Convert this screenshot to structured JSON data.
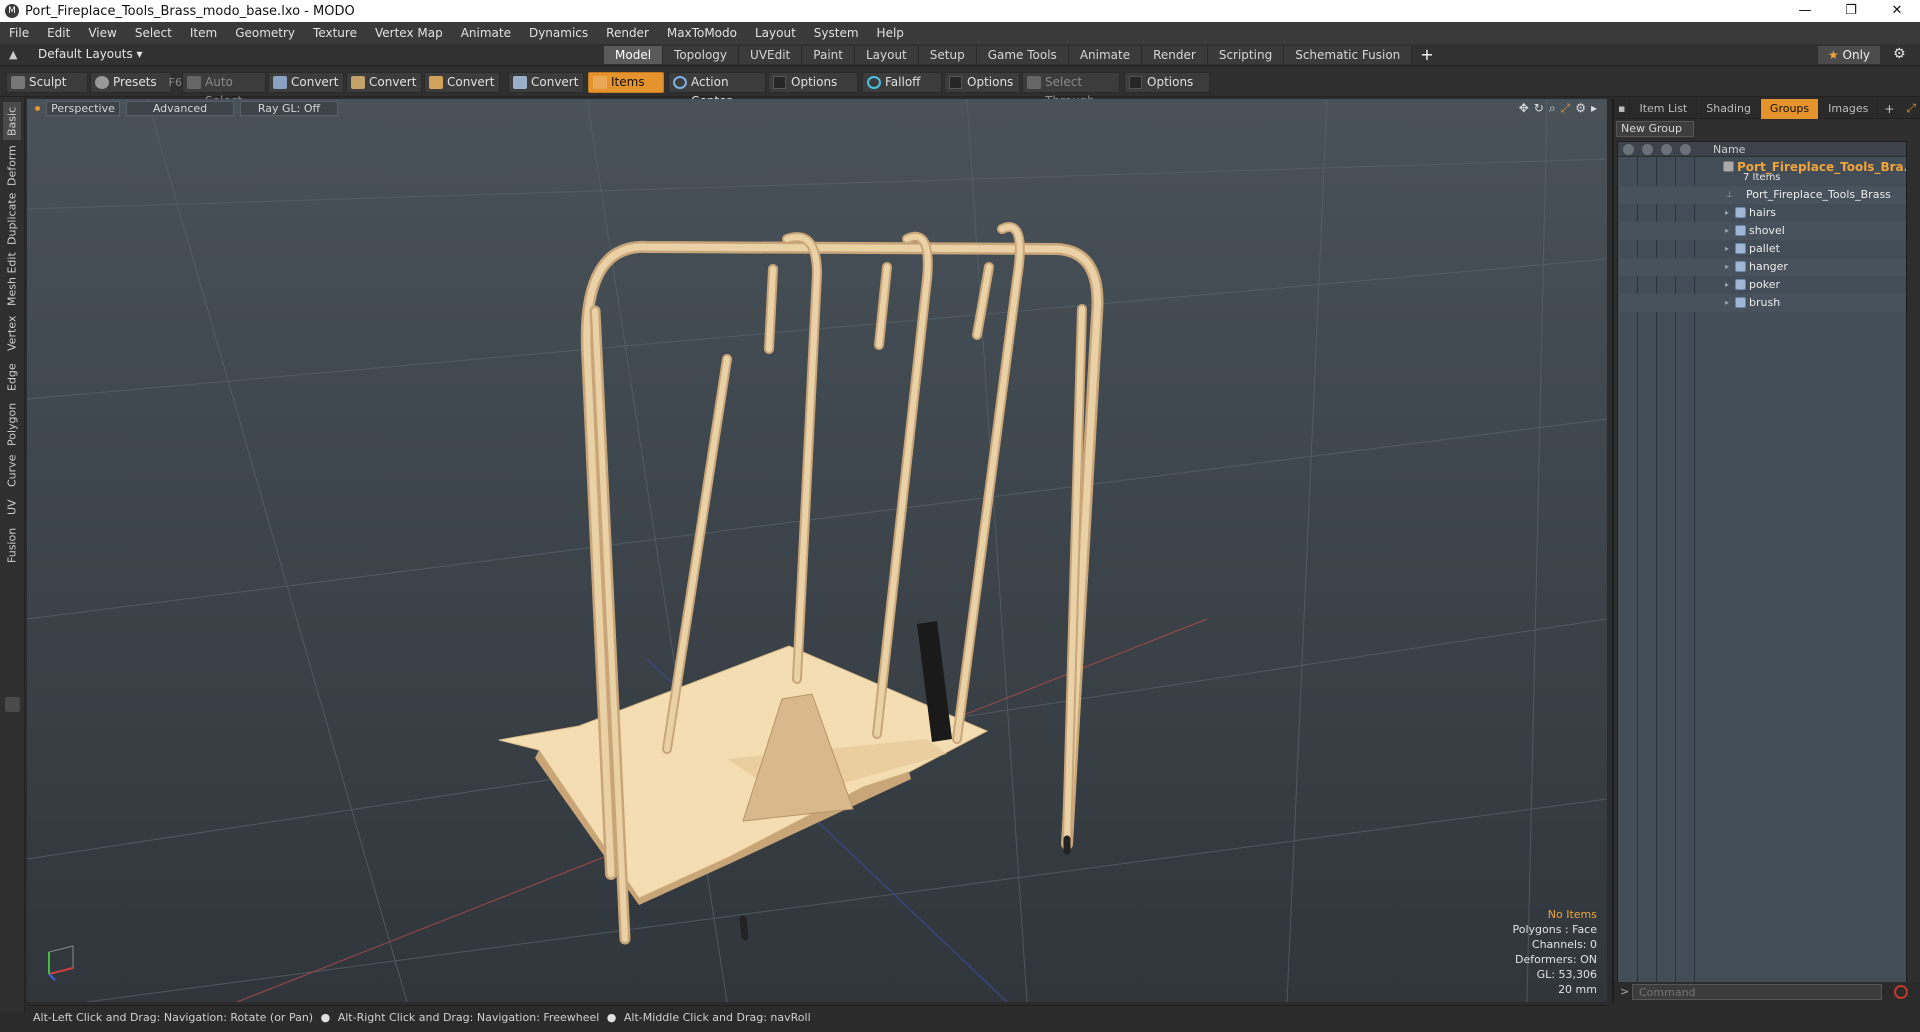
{
  "window": {
    "title": "Port_Fireplace_Tools_Brass_modo_base.lxo - MODO"
  },
  "menu": [
    "File",
    "Edit",
    "View",
    "Select",
    "Item",
    "Geometry",
    "Texture",
    "Vertex Map",
    "Animate",
    "Dynamics",
    "Render",
    "MaxToModo",
    "Layout",
    "System",
    "Help"
  ],
  "layouts": {
    "default_label": "Default Layouts",
    "tabs": [
      "Model",
      "Topology",
      "UVEdit",
      "Paint",
      "Layout",
      "Setup",
      "Game Tools",
      "Animate",
      "Render",
      "Scripting",
      "Schematic Fusion"
    ],
    "active_tab": "Model",
    "only_label": "Only"
  },
  "toolbar": {
    "sculpt": "Sculpt",
    "presets": "Presets",
    "presets_hotkey": "F6",
    "auto_select": "Auto Select",
    "convert1": "Convert",
    "convert2": "Convert",
    "convert3": "Convert",
    "convert4": "Convert",
    "items": "Items",
    "action_center": "Action Center",
    "options1": "Options",
    "falloff": "Falloff",
    "options2": "Options",
    "select_through": "Select Through",
    "options3": "Options"
  },
  "left_tabs": [
    "Basic",
    "Deform",
    "Duplicate",
    "Mesh Edit",
    "Vertex",
    "Edge",
    "Polygon",
    "Curve",
    "UV",
    "Fusion"
  ],
  "viewport": {
    "perspective": "Perspective",
    "advanced": "Advanced",
    "raygl": "Ray GL: Off",
    "info": {
      "selection": "No Items",
      "polygons": "Polygons : Face",
      "channels": "Channels: 0",
      "deformers": "Deformers: ON",
      "gl": "GL: 53,306",
      "scale": "20 mm"
    }
  },
  "status_bar": {
    "hint1": "Alt-Left Click and Drag: Navigation: Rotate (or Pan)",
    "hint2": "Alt-Right Click and Drag: Navigation: Freewheel",
    "hint3": "Alt-Middle Click and Drag: navRoll"
  },
  "right_panel": {
    "tabs": [
      "Item List",
      "Shading",
      "Groups",
      "Images"
    ],
    "active_tab": "Groups",
    "new_group": "New Group",
    "column_name": "Name",
    "group": {
      "name": "Port_Fireplace_Tools_Bra...",
      "count": "7 Items"
    },
    "items": [
      "Port_Fireplace_Tools_Brass",
      "hairs",
      "shovel",
      "pallet",
      "hanger",
      "poker",
      "brush"
    ],
    "command_placeholder": "Command"
  },
  "colors": {
    "accent": "#e5932c",
    "model": "#e9c99a"
  }
}
